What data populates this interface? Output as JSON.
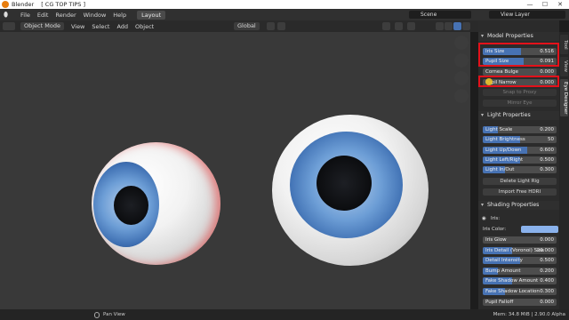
{
  "titlebar": {
    "app": "Blender",
    "file": "[ CG TOP TIPS ]",
    "minimize": "—",
    "maximize": "☐",
    "close": "✕"
  },
  "menu": [
    "File",
    "Edit",
    "Render",
    "Window",
    "Help"
  ],
  "workspace_tab": "Layout",
  "scene": "Scene",
  "view_layer": "View Layer",
  "viewport_header": {
    "mode": "Object Mode",
    "menus": [
      "View",
      "Select",
      "Add",
      "Object"
    ],
    "orientation": "Global"
  },
  "sidebar_tabs": [
    "Tool",
    "View",
    "Eye Designer"
  ],
  "model_properties": {
    "title": "Model Properties",
    "iris_size": {
      "label": "Iris Size",
      "value": "0.516",
      "fill": 0.52
    },
    "pupil_size": {
      "label": "Pupil Size",
      "value": "0.091",
      "fill": 0.55
    },
    "cornea_bulge": {
      "label": "Cornea Bulge",
      "value": "0.000"
    },
    "pupil_narrow": {
      "label": "Pupil Narrow",
      "value": "0.000"
    },
    "snap_to_proxy": "Snap to Proxy",
    "mirror_eye": "Mirror Eye"
  },
  "light_properties": {
    "title": "Light Properties",
    "rows": [
      {
        "label": "Light Scale",
        "value": "0.200",
        "fill": 0.2
      },
      {
        "label": "Light Brightness",
        "value": "50",
        "fill": 0.5
      },
      {
        "label": "Light Up/Down",
        "value": "0.600",
        "fill": 0.6
      },
      {
        "label": "Light Left/Right",
        "value": "0.500",
        "fill": 0.5
      },
      {
        "label": "Light In/Out",
        "value": "0.300",
        "fill": 0.3
      }
    ],
    "delete_rig": "Delete Light Rig",
    "import_hdri": "Import Free HDRI"
  },
  "shading_properties": {
    "title": "Shading Properties",
    "iris_label": "Iris:",
    "iris_color_label": "Iris Color:",
    "iris_color": "#8ab2ec",
    "rows": [
      {
        "label": "Iris Glow",
        "value": "0.000",
        "fill": 0.0
      },
      {
        "label": "Iris Detail (Voronoi) Size",
        "value": "20.000",
        "fill": 0.4
      },
      {
        "label": "Detail Intensity",
        "value": "0.500",
        "fill": 0.5
      },
      {
        "label": "Bump Amount",
        "value": "0.200",
        "fill": 0.2
      },
      {
        "label": "Fake Shadow Amount",
        "value": "0.400",
        "fill": 0.4
      },
      {
        "label": "Fake Shadow Location",
        "value": "0.300",
        "fill": 0.3
      },
      {
        "label": "Pupil Falloff",
        "value": "0.000",
        "fill": 0.0
      }
    ]
  },
  "statusbar": {
    "left": "Pan View",
    "right": "Mem: 34.8 MiB | 2.90.0 Alpha"
  }
}
